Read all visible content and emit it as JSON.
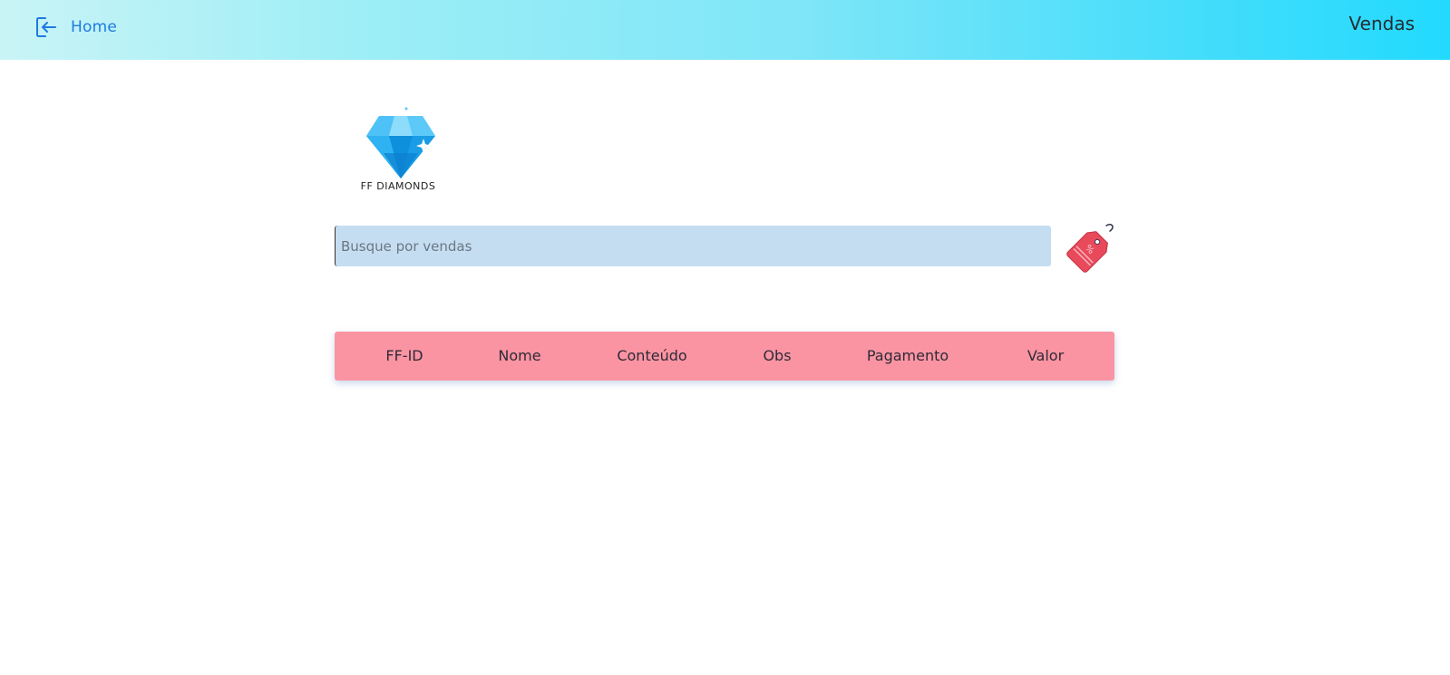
{
  "header": {
    "home_label": "Home",
    "page_title": "Vendas",
    "accent_color": "#1f7ae0"
  },
  "logo": {
    "brand_text": "FF DIAMONDS",
    "icon": "diamond-logo"
  },
  "search": {
    "placeholder": "Busque por vendas",
    "value": ""
  },
  "tag_button": {
    "icon": "discount-tag-icon"
  },
  "table": {
    "header_color": "#fa94a3",
    "columns": [
      "FF-ID",
      "Nome",
      "Conteúdo",
      "Obs",
      "Pagamento",
      "Valor"
    ],
    "rows": []
  }
}
